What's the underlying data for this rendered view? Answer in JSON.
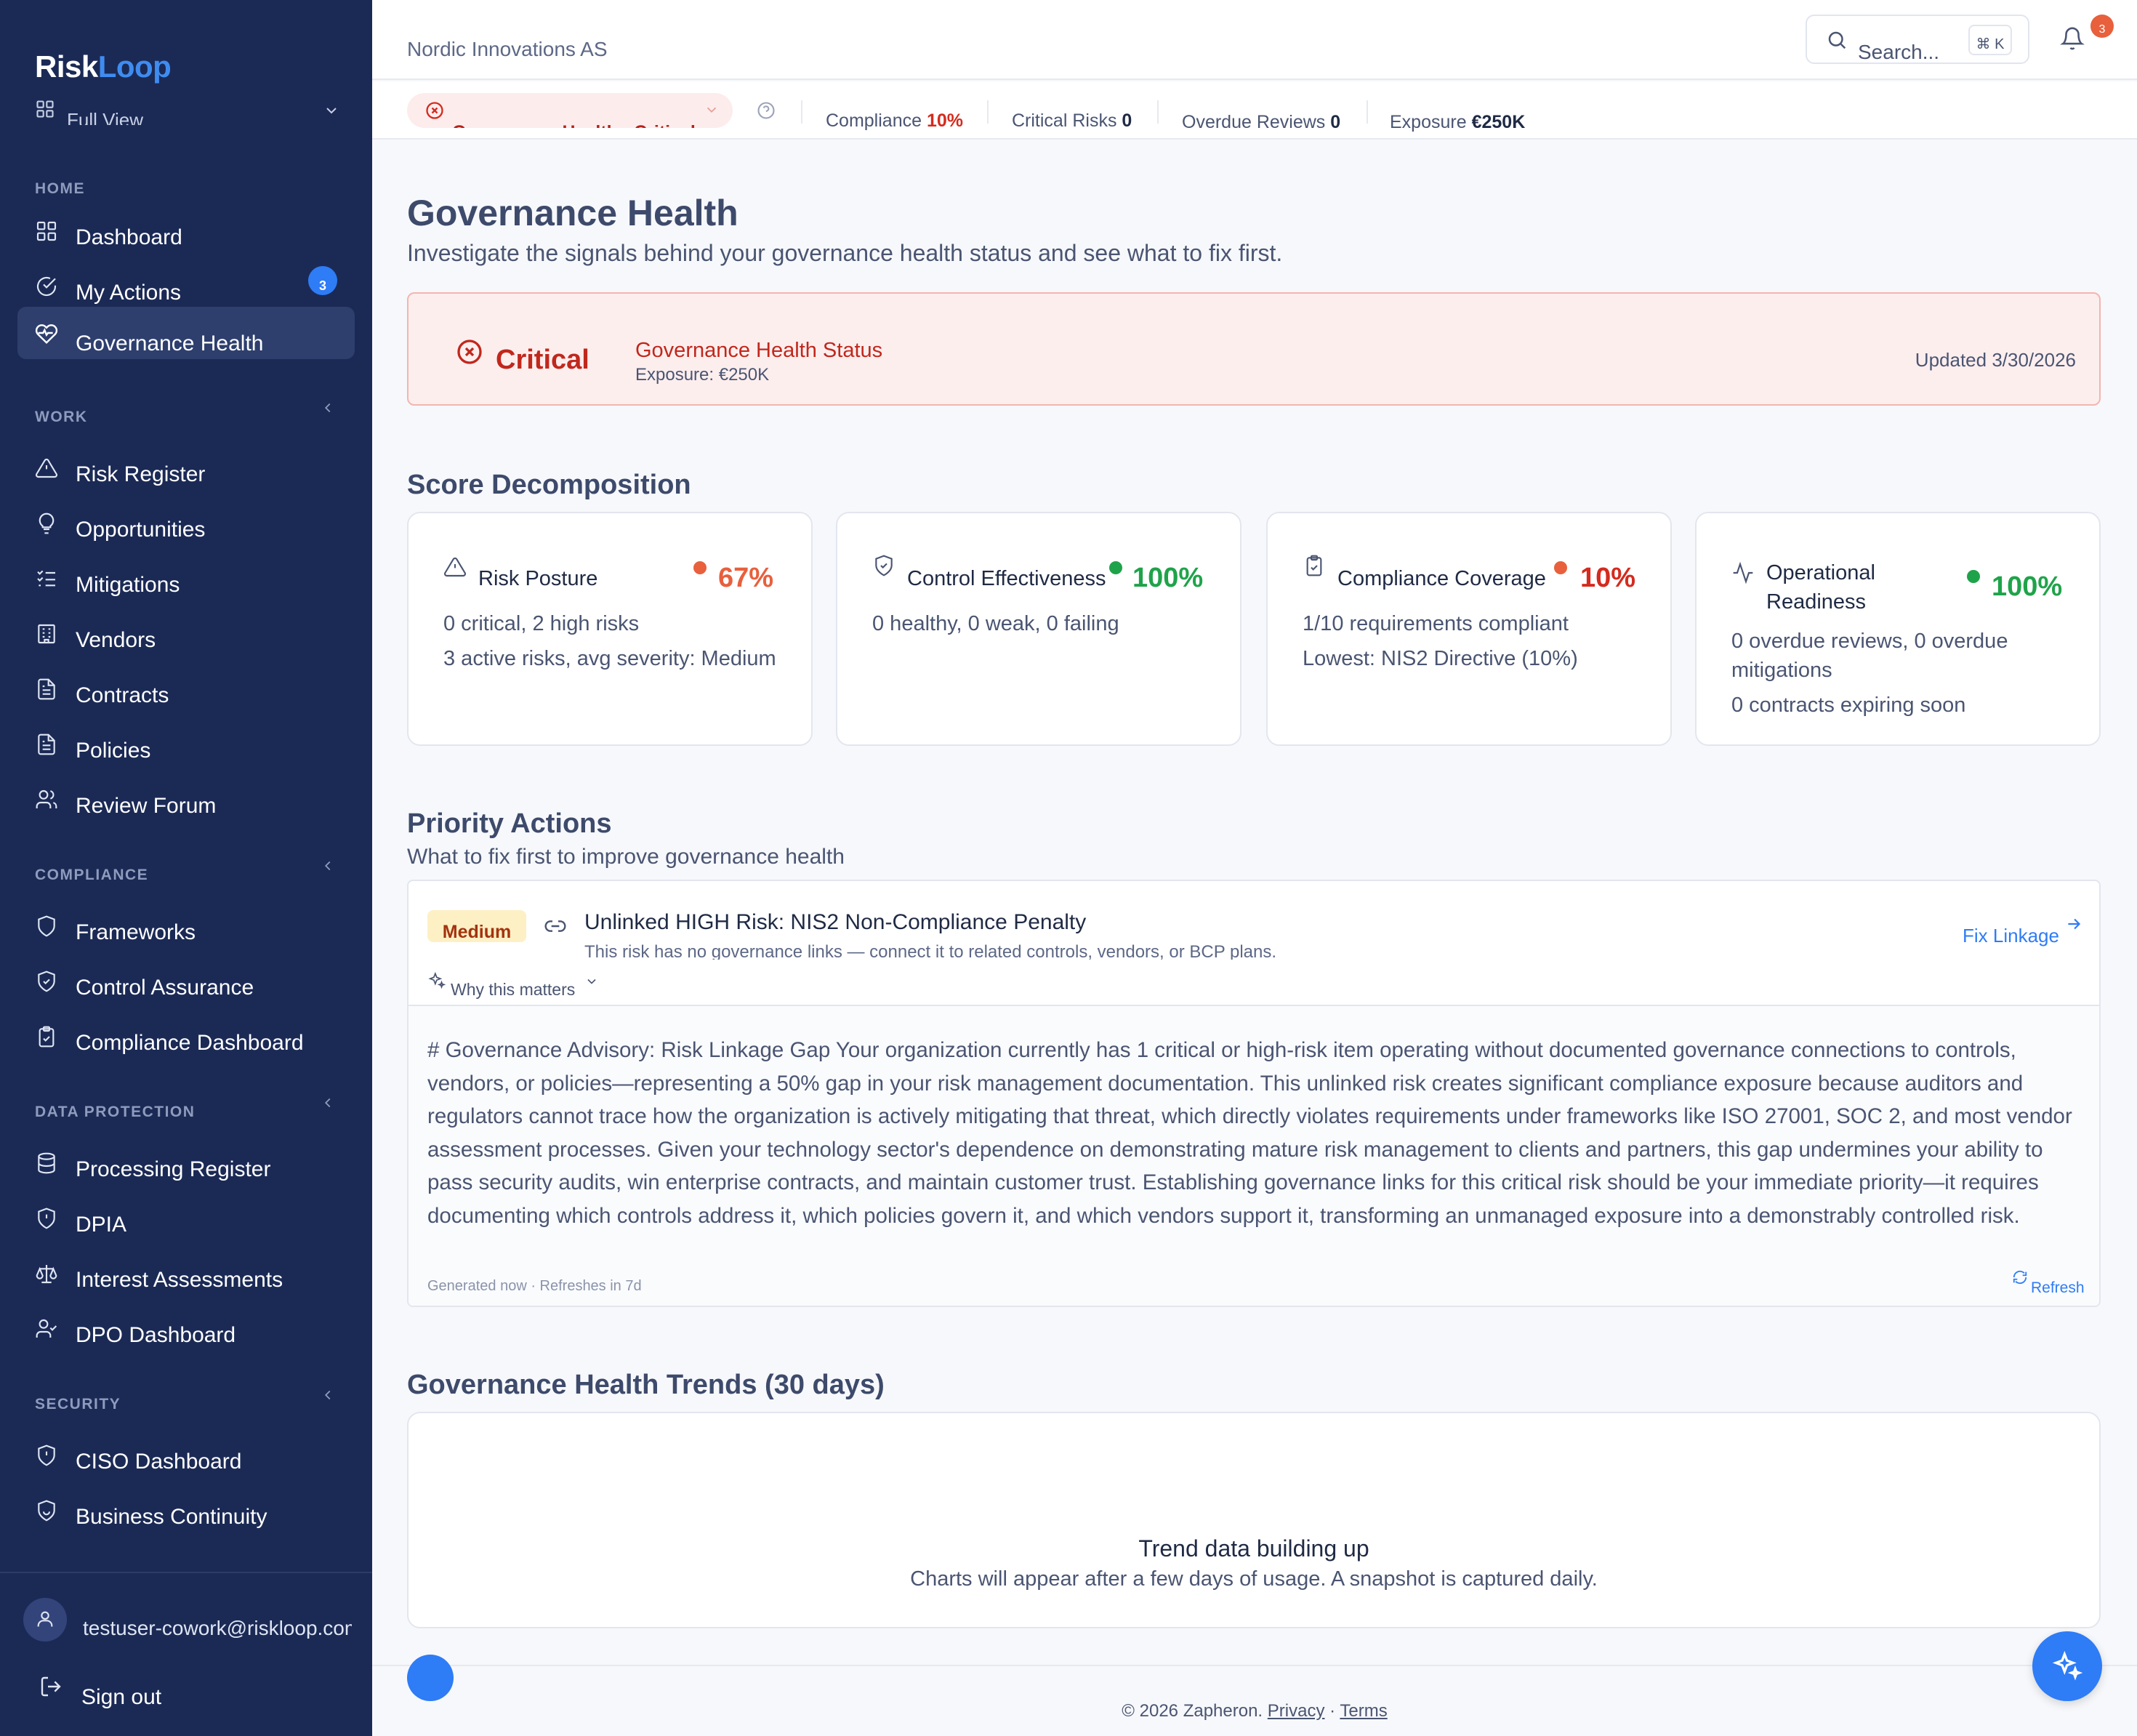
{
  "app": {
    "logo_part1": "Risk",
    "logo_part2": "Loop",
    "view_label": "Full View"
  },
  "sidebar": {
    "home_header": "HOME",
    "home_items": [
      {
        "label": "Dashboard",
        "icon": "grid-icon"
      },
      {
        "label": "My Actions",
        "icon": "check-circle-icon",
        "badge": "3"
      },
      {
        "label": "Governance Health",
        "icon": "heart-pulse-icon",
        "active": true
      }
    ],
    "work_header": "WORK",
    "work_items": [
      {
        "label": "Risk Register",
        "icon": "warning-triangle-icon"
      },
      {
        "label": "Opportunities",
        "icon": "lightbulb-icon"
      },
      {
        "label": "Mitigations",
        "icon": "list-check-icon"
      },
      {
        "label": "Vendors",
        "icon": "building-icon"
      },
      {
        "label": "Contracts",
        "icon": "document-icon"
      },
      {
        "label": "Policies",
        "icon": "document-icon"
      },
      {
        "label": "Review Forum",
        "icon": "users-icon"
      }
    ],
    "compliance_header": "COMPLIANCE",
    "compliance_items": [
      {
        "label": "Frameworks",
        "icon": "shield-icon"
      },
      {
        "label": "Control Assurance",
        "icon": "shield-check-icon"
      },
      {
        "label": "Compliance Dashboard",
        "icon": "clipboard-check-icon"
      }
    ],
    "dp_header": "DATA PROTECTION",
    "dp_items": [
      {
        "label": "Processing Register",
        "icon": "database-icon"
      },
      {
        "label": "DPIA",
        "icon": "shield-alert-icon"
      },
      {
        "label": "Interest Assessments",
        "icon": "scale-icon"
      },
      {
        "label": "DPO Dashboard",
        "icon": "user-check-icon"
      }
    ],
    "security_header": "SECURITY",
    "security_items": [
      {
        "label": "CISO Dashboard",
        "icon": "shield-alert-icon"
      },
      {
        "label": "Business Continuity",
        "icon": "shield-smile-icon"
      }
    ],
    "user_email": "testuser-cowork@riskloop.com",
    "sign_out": "Sign out"
  },
  "topbar": {
    "org_name": "Nordic Innovations AS",
    "search_placeholder": "Search...",
    "search_shortcut": "⌘ K",
    "notification_count": "3"
  },
  "status_strip": {
    "health_label": "Governance Health:",
    "health_value": "Critical",
    "compliance_label": "Compliance",
    "compliance_value": "10%",
    "critical_risks_label": "Critical Risks",
    "critical_risks_value": "0",
    "overdue_label": "Overdue Reviews",
    "overdue_value": "0",
    "exposure_label": "Exposure",
    "exposure_value": "€250K"
  },
  "page": {
    "title": "Governance Health",
    "subtitle": "Investigate the signals behind your governance health status and see what to fix first."
  },
  "status_card": {
    "level": "Critical",
    "title": "Governance Health Status",
    "exposure": "Exposure: €250K",
    "updated": "Updated 3/30/2026"
  },
  "score_decomposition": {
    "heading": "Score Decomposition",
    "cards": [
      {
        "title": "Risk Posture",
        "percent": "67%",
        "status_color": "#e8603c",
        "icon": "warning-triangle-icon",
        "lines": [
          "0 critical, 2 high risks",
          "3 active risks, avg severity: Medium"
        ]
      },
      {
        "title": "Control Effectiveness",
        "percent": "100%",
        "status_color": "#1fa34a",
        "icon": "shield-check-icon",
        "lines": [
          "0 healthy, 0 weak, 0 failing"
        ]
      },
      {
        "title": "Compliance Coverage",
        "percent": "10%",
        "status_color": "#e8603c",
        "icon": "clipboard-check-icon",
        "lines": [
          "1/10 requirements compliant",
          "Lowest: NIS2 Directive (10%)"
        ]
      },
      {
        "title": "Operational Readiness",
        "percent": "100%",
        "status_color": "#1fa34a",
        "icon": "activity-icon",
        "lines": [
          "0 overdue reviews, 0 overdue mitigations",
          "0 contracts expiring soon"
        ]
      }
    ]
  },
  "priority_actions": {
    "heading": "Priority Actions",
    "subheading": "What to fix first to improve governance health",
    "items": [
      {
        "severity": "Medium",
        "title": "Unlinked HIGH Risk: NIS2 Non-Compliance Penalty",
        "description": "This risk has no governance links — connect it to related controls, vendors, or BCP plans.",
        "why_label": "Why this matters",
        "fix_label": "Fix Linkage",
        "advisory": "# Governance Advisory: Risk Linkage Gap Your organization currently has 1 critical or high-risk item operating without documented governance connections to controls, vendors, or policies—representing a 50% gap in your risk management documentation. This unlinked risk creates significant compliance exposure because auditors and regulators cannot trace how the organization is actively mitigating that threat, which directly violates requirements under frameworks like ISO 27001, SOC 2, and most vendor assessment processes. Given your technology sector's dependence on demonstrating mature risk management to clients and partners, this gap undermines your ability to pass security audits, win enterprise contracts, and maintain customer trust. Establishing governance links for this critical risk should be your immediate priority—it requires documenting which controls address it, which policies govern it, and which vendors support it, transforming an unmanaged exposure into a demonstrably controlled risk.",
        "generated": "Generated now · Refreshes in 7d",
        "refresh_label": "Refresh"
      }
    ]
  },
  "trends": {
    "heading": "Governance Health Trends (30 days)",
    "empty_title": "Trend data building up",
    "empty_text": "Charts will appear after a few days of usage. A snapshot is captured daily."
  },
  "footer": {
    "copyright": "© 2026 Zapheron.",
    "privacy": "Privacy",
    "separator": "·",
    "terms": "Terms"
  },
  "colors": {
    "sidebar_bg": "#1b2a55",
    "accent": "#2e7cf6",
    "critical": "#c0281c",
    "warning": "#e8603c",
    "success": "#1fa34a"
  }
}
